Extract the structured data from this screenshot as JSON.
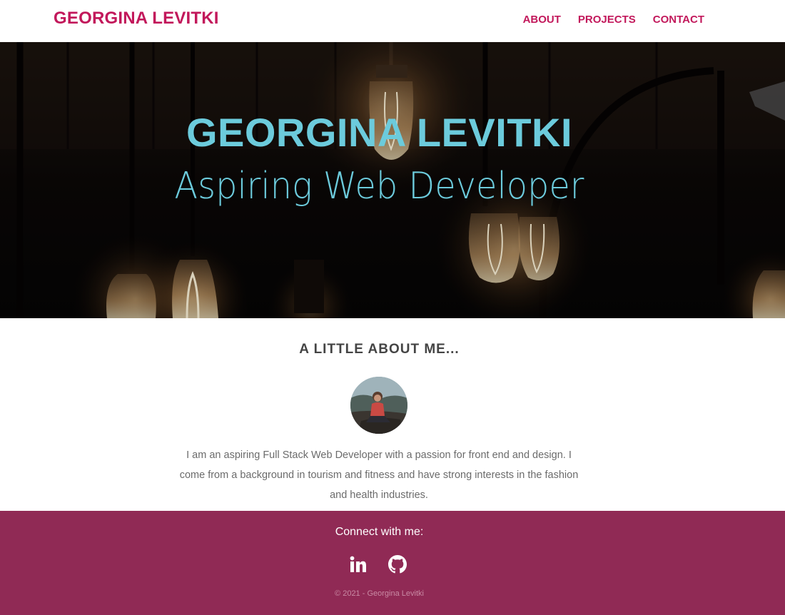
{
  "navbar": {
    "brand": "GEORGINA LEVITKI",
    "links": [
      {
        "label": "ABOUT"
      },
      {
        "label": "PROJECTS"
      },
      {
        "label": "CONTACT"
      }
    ]
  },
  "hero": {
    "title": "GEORGINA LEVITKI",
    "subtitle": "Aspiring Web Developer"
  },
  "about": {
    "heading": "A LITTLE ABOUT ME...",
    "text": "I am an aspiring Full Stack Web Developer with a passion for front end and design. I come from a background in tourism and fitness and have strong interests in the fashion and health industries."
  },
  "footer": {
    "connect_label": "Connect with me:",
    "social": [
      {
        "icon": "linkedin-icon"
      },
      {
        "icon": "github-icon"
      }
    ],
    "copyright": "© 2021 - Georgina Levitki"
  },
  "colors": {
    "brand_pink": "#c2185b",
    "hero_text": "#6ccbdc",
    "footer_bg": "#902a55",
    "heading_text": "#444444",
    "body_text": "#6b6b6b"
  }
}
